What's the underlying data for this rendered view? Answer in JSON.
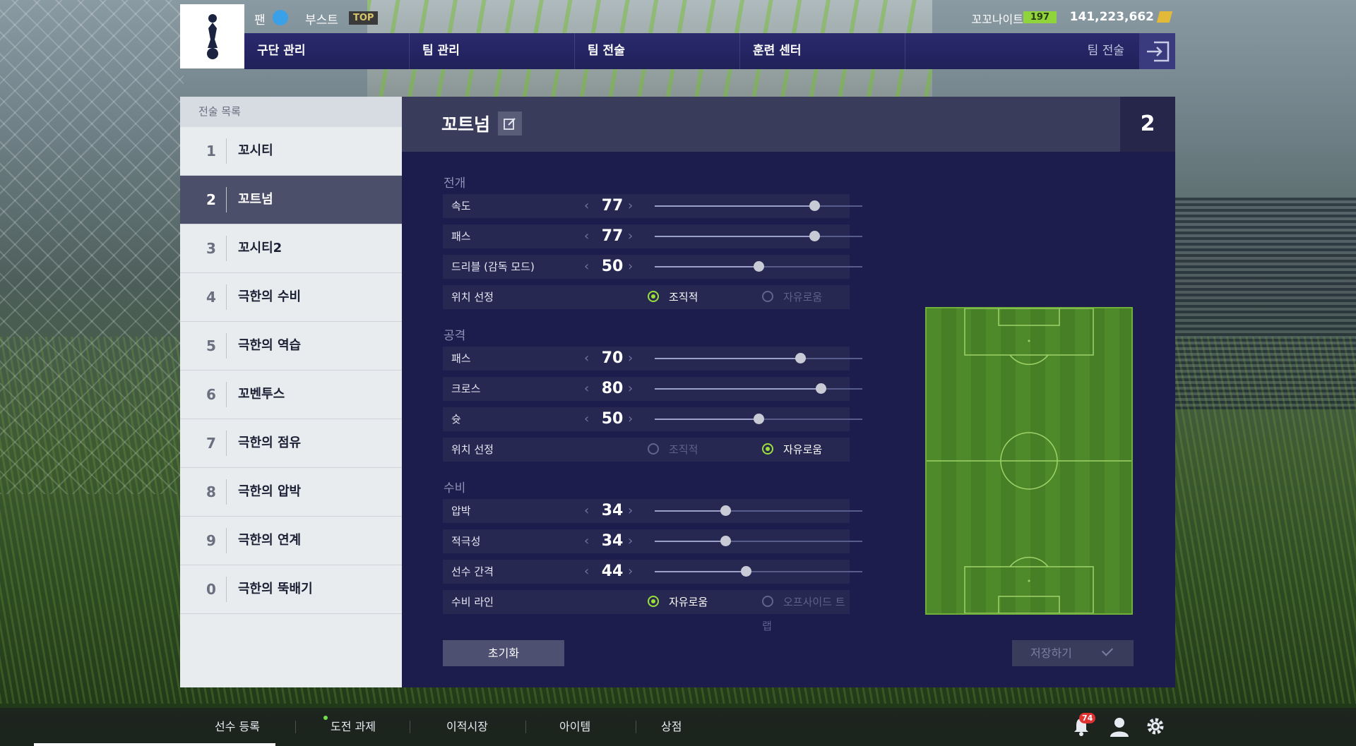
{
  "header": {
    "fan_label": "팬",
    "boost_label": "부스트",
    "top_badge": "TOP",
    "user_name": "꼬꼬나이트",
    "level": "197",
    "coins": "141,223,662"
  },
  "nav": {
    "items": [
      "구단 관리",
      "팀 관리",
      "팀 전술",
      "훈련 센터"
    ],
    "current": "팀 전술"
  },
  "tactics_list": {
    "title": "전술 목록",
    "items": [
      {
        "num": "1",
        "name": "꼬시티"
      },
      {
        "num": "2",
        "name": "꼬트넘"
      },
      {
        "num": "3",
        "name": "꼬시티2"
      },
      {
        "num": "4",
        "name": "극한의 수비"
      },
      {
        "num": "5",
        "name": "극한의 역습"
      },
      {
        "num": "6",
        "name": "꼬벤투스"
      },
      {
        "num": "7",
        "name": "극한의 점유"
      },
      {
        "num": "8",
        "name": "극한의 압박"
      },
      {
        "num": "9",
        "name": "극한의 연계"
      },
      {
        "num": "0",
        "name": "극한의 뚝배기"
      }
    ],
    "selected_index": 1
  },
  "tactic": {
    "name": "꼬트넘",
    "slot": "2",
    "buildup": {
      "title": "전개",
      "speed": {
        "label": "속도",
        "value": 77
      },
      "passing": {
        "label": "패스",
        "value": 77
      },
      "dribbling": {
        "label": "드리블 (감독 모드)",
        "value": 50
      },
      "positioning": {
        "label": "위치 선정",
        "option_a": "조직적",
        "option_b": "자유로움",
        "selected": "조직적"
      }
    },
    "attack": {
      "title": "공격",
      "passing": {
        "label": "패스",
        "value": 70
      },
      "crossing": {
        "label": "크로스",
        "value": 80
      },
      "shooting": {
        "label": "슛",
        "value": 50
      },
      "positioning": {
        "label": "위치 선정",
        "option_a": "조직적",
        "option_b": "자유로움",
        "selected": "자유로움"
      }
    },
    "defence": {
      "title": "수비",
      "pressure": {
        "label": "압박",
        "value": 34
      },
      "aggression": {
        "label": "적극성",
        "value": 34
      },
      "width": {
        "label": "선수 간격",
        "value": 44
      },
      "line": {
        "label": "수비 라인",
        "option_a": "자유로움",
        "option_b": "오프사이드 트랩",
        "selected": "자유로움"
      }
    },
    "reset_label": "초기화",
    "save_label": "저장하기"
  },
  "bottom_bar": {
    "items": [
      "선수 등록",
      "도전 과제",
      "이적시장",
      "아이템",
      "상점"
    ],
    "notification_count": "74"
  },
  "colors": {
    "accent_green": "#9be03a",
    "nav_bg": "#2a2a6e",
    "panel_bg": "#1d1d4d"
  },
  "icons": [
    "smile-icon",
    "coin-icon",
    "exit-icon",
    "edit-icon",
    "check-icon",
    "bell-icon",
    "user-icon",
    "gear-icon"
  ]
}
